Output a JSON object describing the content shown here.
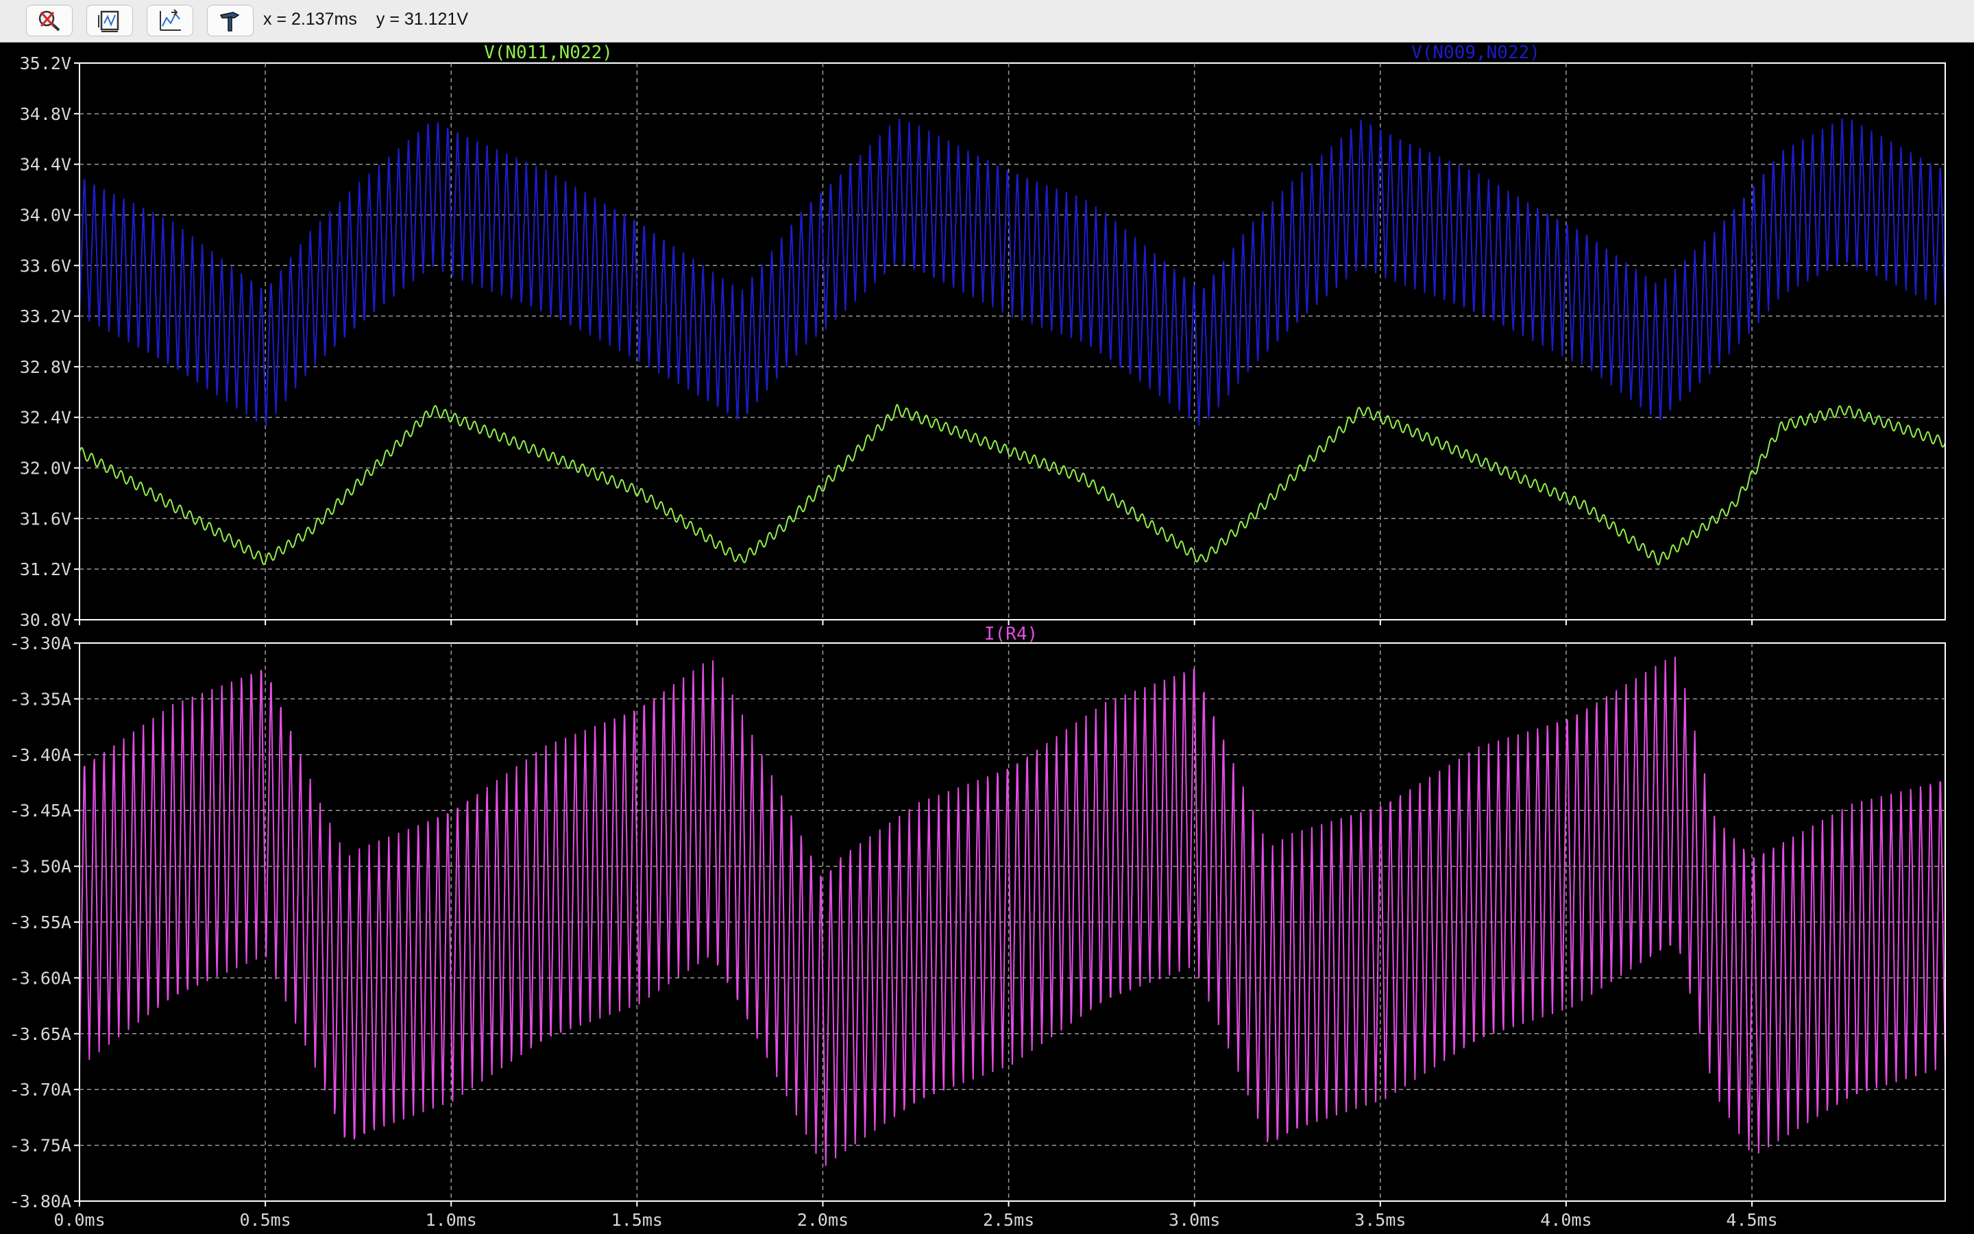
{
  "toolbar": {
    "buttons": [
      {
        "name": "zoom-cancel-button",
        "icon": "zoom-cancel-icon"
      },
      {
        "name": "autorange-button",
        "icon": "autorange-icon"
      },
      {
        "name": "pan-button",
        "icon": "pan-icon"
      },
      {
        "name": "settings-button",
        "icon": "hammer-icon"
      }
    ],
    "cursor_x": "x = 2.137ms",
    "cursor_y": "y = 31.121V"
  },
  "colors": {
    "background": "#000000",
    "frame": "#ffffff",
    "grid": "#9a9a9a",
    "axis_text": "#d8d8d8",
    "green_trace": "#8ff04a",
    "blue_trace": "#1c1ccd",
    "magenta_trace": "#e34de3"
  },
  "chart_data": [
    {
      "type": "line",
      "x_ticks": [
        "0.0ms",
        "0.5ms",
        "1.0ms",
        "1.5ms",
        "2.0ms",
        "2.5ms",
        "3.0ms",
        "3.5ms",
        "4.0ms",
        "4.5ms"
      ],
      "xlim": [
        0,
        5.02
      ],
      "ylim": [
        30.8,
        35.2
      ],
      "y_ticks": [
        "35.2V",
        "34.8V",
        "34.4V",
        "34.0V",
        "33.6V",
        "33.2V",
        "32.8V",
        "32.4V",
        "32.0V",
        "31.6V",
        "31.2V",
        "30.8V"
      ],
      "grid": true,
      "series": [
        {
          "name": "V(N011,N022)",
          "color": "#8ff04a",
          "envelope_mean": [
            [
              0,
              32.13
            ],
            [
              0.25,
              31.7
            ],
            [
              0.5,
              31.27
            ],
            [
              0.62,
              31.5
            ],
            [
              0.95,
              32.46
            ],
            [
              1.5,
              31.82
            ],
            [
              1.78,
              31.27
            ],
            [
              1.9,
              31.55
            ],
            [
              2.2,
              32.46
            ],
            [
              2.7,
              31.92
            ],
            [
              3.02,
              31.27
            ],
            [
              3.15,
              31.6
            ],
            [
              3.45,
              32.46
            ],
            [
              4.05,
              31.7
            ],
            [
              4.25,
              31.27
            ],
            [
              4.45,
              31.7
            ],
            [
              4.58,
              32.33
            ],
            [
              4.75,
              32.46
            ],
            [
              5.02,
              32.2
            ]
          ],
          "ripple_amplitude": 0.04,
          "ripple_cycles": 190
        },
        {
          "name": "V(N009,N022)",
          "color": "#1c1ccd",
          "envelope_upper": [
            [
              0,
              34.35
            ],
            [
              0.25,
              33.95
            ],
            [
              0.5,
              33.45
            ],
            [
              0.62,
              33.9
            ],
            [
              0.95,
              34.8
            ],
            [
              1.5,
              34.0
            ],
            [
              1.78,
              33.4
            ],
            [
              1.95,
              34.1
            ],
            [
              2.2,
              34.78
            ],
            [
              2.7,
              34.15
            ],
            [
              3.02,
              33.45
            ],
            [
              3.15,
              33.95
            ],
            [
              3.45,
              34.8
            ],
            [
              4.05,
              33.9
            ],
            [
              4.25,
              33.45
            ],
            [
              4.4,
              33.9
            ],
            [
              4.58,
              34.55
            ],
            [
              4.75,
              34.78
            ],
            [
              5.02,
              34.4
            ]
          ],
          "envelope_lower": [
            [
              0,
              33.2
            ],
            [
              0.25,
              32.75
            ],
            [
              0.5,
              32.32
            ],
            [
              0.62,
              32.75
            ],
            [
              0.95,
              33.58
            ],
            [
              1.5,
              32.85
            ],
            [
              1.78,
              32.32
            ],
            [
              1.95,
              32.95
            ],
            [
              2.2,
              33.58
            ],
            [
              2.7,
              32.95
            ],
            [
              3.02,
              32.32
            ],
            [
              3.15,
              32.75
            ],
            [
              3.45,
              33.58
            ],
            [
              4.05,
              32.8
            ],
            [
              4.25,
              32.32
            ],
            [
              4.4,
              32.75
            ],
            [
              4.58,
              33.35
            ],
            [
              4.75,
              33.58
            ],
            [
              5.02,
              33.25
            ]
          ],
          "ripple_cycles": 190
        }
      ]
    },
    {
      "type": "line",
      "x_ticks": [
        "0.0ms",
        "0.5ms",
        "1.0ms",
        "1.5ms",
        "2.0ms",
        "2.5ms",
        "3.0ms",
        "3.5ms",
        "4.0ms",
        "4.5ms"
      ],
      "xlim": [
        0,
        5.02
      ],
      "ylim": [
        -3.8,
        -3.3
      ],
      "y_ticks": [
        "-3.30A",
        "-3.35A",
        "-3.40A",
        "-3.45A",
        "-3.50A",
        "-3.55A",
        "-3.60A",
        "-3.65A",
        "-3.70A",
        "-3.75A",
        "-3.80A"
      ],
      "grid": true,
      "series": [
        {
          "name": "I(R4)",
          "color": "#e34de3",
          "envelope_upper": [
            [
              0,
              -3.4
            ],
            [
              0.5,
              -3.31
            ],
            [
              0.65,
              -3.44
            ],
            [
              0.72,
              -3.49
            ],
            [
              1.7,
              -3.31
            ],
            [
              2.0,
              -3.5
            ],
            [
              2.05,
              -3.48
            ],
            [
              3.0,
              -3.31
            ],
            [
              3.2,
              -3.48
            ],
            [
              4.3,
              -3.31
            ],
            [
              4.4,
              -3.45
            ],
            [
              4.5,
              -3.48
            ],
            [
              5.02,
              -3.41
            ]
          ],
          "envelope_lower": [
            [
              0,
              -3.68
            ],
            [
              0.5,
              -3.58
            ],
            [
              0.65,
              -3.7
            ],
            [
              0.72,
              -3.76
            ],
            [
              1.7,
              -3.59
            ],
            [
              2.0,
              -3.77
            ],
            [
              2.05,
              -3.76
            ],
            [
              3.0,
              -3.59
            ],
            [
              3.2,
              -3.76
            ],
            [
              4.3,
              -3.58
            ],
            [
              4.4,
              -3.71
            ],
            [
              4.5,
              -3.76
            ],
            [
              5.02,
              -3.68
            ]
          ],
          "ripple_cycles": 190
        }
      ]
    }
  ]
}
